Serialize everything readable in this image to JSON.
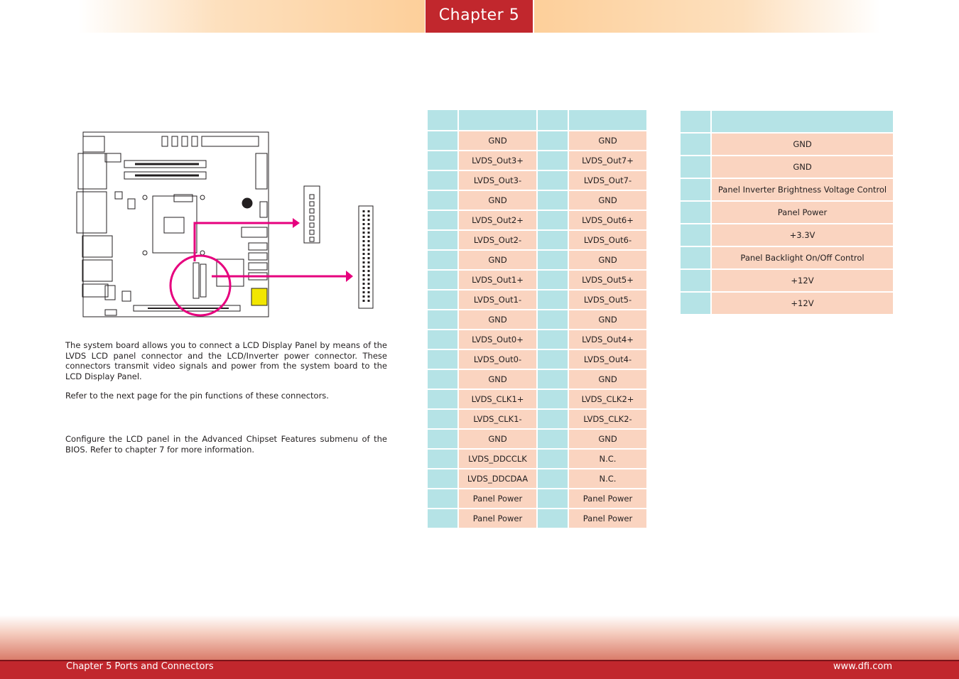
{
  "header": {
    "chapter_label": "Chapter  5"
  },
  "intro": {
    "para1": "The system board allows you to connect a LCD Display Panel by means of the LVDS LCD panel connector and the LCD/Inverter power connector. These connectors transmit video signals and power from the system board to the LCD Display Panel.",
    "para2": "Refer to the next page for the pin functions of these connectors.",
    "para3": "Configure the LCD panel in the Advanced Chipset Features submenu of the BIOS. Refer to chapter 7 for more information."
  },
  "lvds_table": {
    "rows": [
      [
        "GND",
        "GND"
      ],
      [
        "LVDS_Out3+",
        "LVDS_Out7+"
      ],
      [
        "LVDS_Out3-",
        "LVDS_Out7-"
      ],
      [
        "GND",
        "GND"
      ],
      [
        "LVDS_Out2+",
        "LVDS_Out6+"
      ],
      [
        "LVDS_Out2-",
        "LVDS_Out6-"
      ],
      [
        "GND",
        "GND"
      ],
      [
        "LVDS_Out1+",
        "LVDS_Out5+"
      ],
      [
        "LVDS_Out1-",
        "LVDS_Out5-"
      ],
      [
        "GND",
        "GND"
      ],
      [
        "LVDS_Out0+",
        "LVDS_Out4+"
      ],
      [
        "LVDS_Out0-",
        "LVDS_Out4-"
      ],
      [
        "GND",
        "GND"
      ],
      [
        "LVDS_CLK1+",
        "LVDS_CLK2+"
      ],
      [
        "LVDS_CLK1-",
        "LVDS_CLK2-"
      ],
      [
        "GND",
        "GND"
      ],
      [
        "LVDS_DDCCLK",
        "N.C."
      ],
      [
        "LVDS_DDCDAA",
        "N.C."
      ],
      [
        "Panel Power",
        "Panel Power"
      ],
      [
        "Panel Power",
        "Panel Power"
      ]
    ]
  },
  "inverter_table": {
    "rows": [
      "GND",
      "GND",
      "Panel Inverter Brightness Voltage Control",
      "Panel Power",
      "+3.3V",
      "Panel Backlight On/Off Control",
      "+12V",
      "+12V"
    ]
  },
  "footer": {
    "left": "Chapter 5 Ports and Connectors",
    "right": "www.dfi.com"
  },
  "colors": {
    "brand_red": "#c1272d",
    "table_header": "#b5e3e6",
    "table_cell": "#fad4c0",
    "highlight_magenta": "#e6007e"
  }
}
